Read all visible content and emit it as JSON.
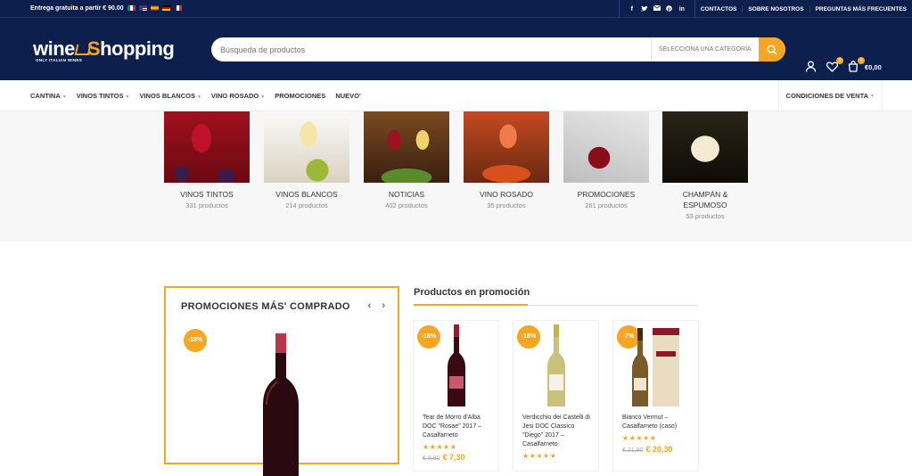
{
  "topbar": {
    "shipping_text": "Entrega gratuita a partir € 90.00",
    "flags": [
      "italian-flag",
      "english-flag",
      "spanish-flag",
      "german-flag",
      "french-flag"
    ],
    "social_icons": [
      "facebook-icon",
      "twitter-icon",
      "email-icon",
      "pinterest-icon",
      "linkedin-icon"
    ],
    "links": [
      "CONTACTOS",
      "SOBRE NOSOTROS",
      "PREGUNTAS MÁS FRECUENTES"
    ]
  },
  "header": {
    "logo_text_1": "wine",
    "logo_text_2": "hopping",
    "logo_tagline": "ONLY ITALIAN WINES",
    "search_placeholder": "Búsqueda de productos",
    "category_select": "SELECCIONA UNA CATEGORÍA",
    "wishlist_count": "0",
    "cart_count": "0",
    "cart_total": "€0,00"
  },
  "nav": {
    "items": [
      "CANTINA",
      "VINOS TINTOS",
      "VINOS BLANCOS",
      "VINO ROSADO",
      "PROMOCIONES",
      "NUEVO'"
    ],
    "right_item": "CONDICIONES DE VENTA"
  },
  "categories": [
    {
      "name": "VINOS TINTOS",
      "count": "331 productos"
    },
    {
      "name": "VINOS BLANCOS",
      "count": "214 productos"
    },
    {
      "name": "NOTICIAS",
      "count": "402 productos"
    },
    {
      "name": "VINO ROSADO",
      "count": "35 productos"
    },
    {
      "name": "PROMOCIONES",
      "count": "261 productos"
    },
    {
      "name": "CHAMPÁN & ESPUMOSO",
      "count": "53 productos"
    }
  ],
  "bestseller": {
    "title": "PROMOCIONES MÁS' COMPRADO",
    "discount": "-18%"
  },
  "promo_products": {
    "title": "Productos en promoción",
    "items": [
      {
        "discount": "-18%",
        "name": "Tear de Morro d'Alba DOC \"Rosae\" 2017 – Casalfarneto",
        "stars": "★★★★★",
        "old_price": "€ 8,90",
        "new_price": "€ 7,30"
      },
      {
        "discount": "-18%",
        "name": "Verdicchio dei Castelli di Jesi DOC Classico \"Diego\" 2017 – Casalfarneto",
        "stars": "★★★★★",
        "old_price": "",
        "new_price": ""
      },
      {
        "discount": "-7%",
        "name": "Bianco Vermut – Casalfarneto (caso)",
        "stars": "★★★★★",
        "old_price": "€ 21,90",
        "new_price": "€ 20,30"
      }
    ]
  },
  "colors": {
    "navy": "#0c1f4d",
    "accent": "#f5a623"
  }
}
